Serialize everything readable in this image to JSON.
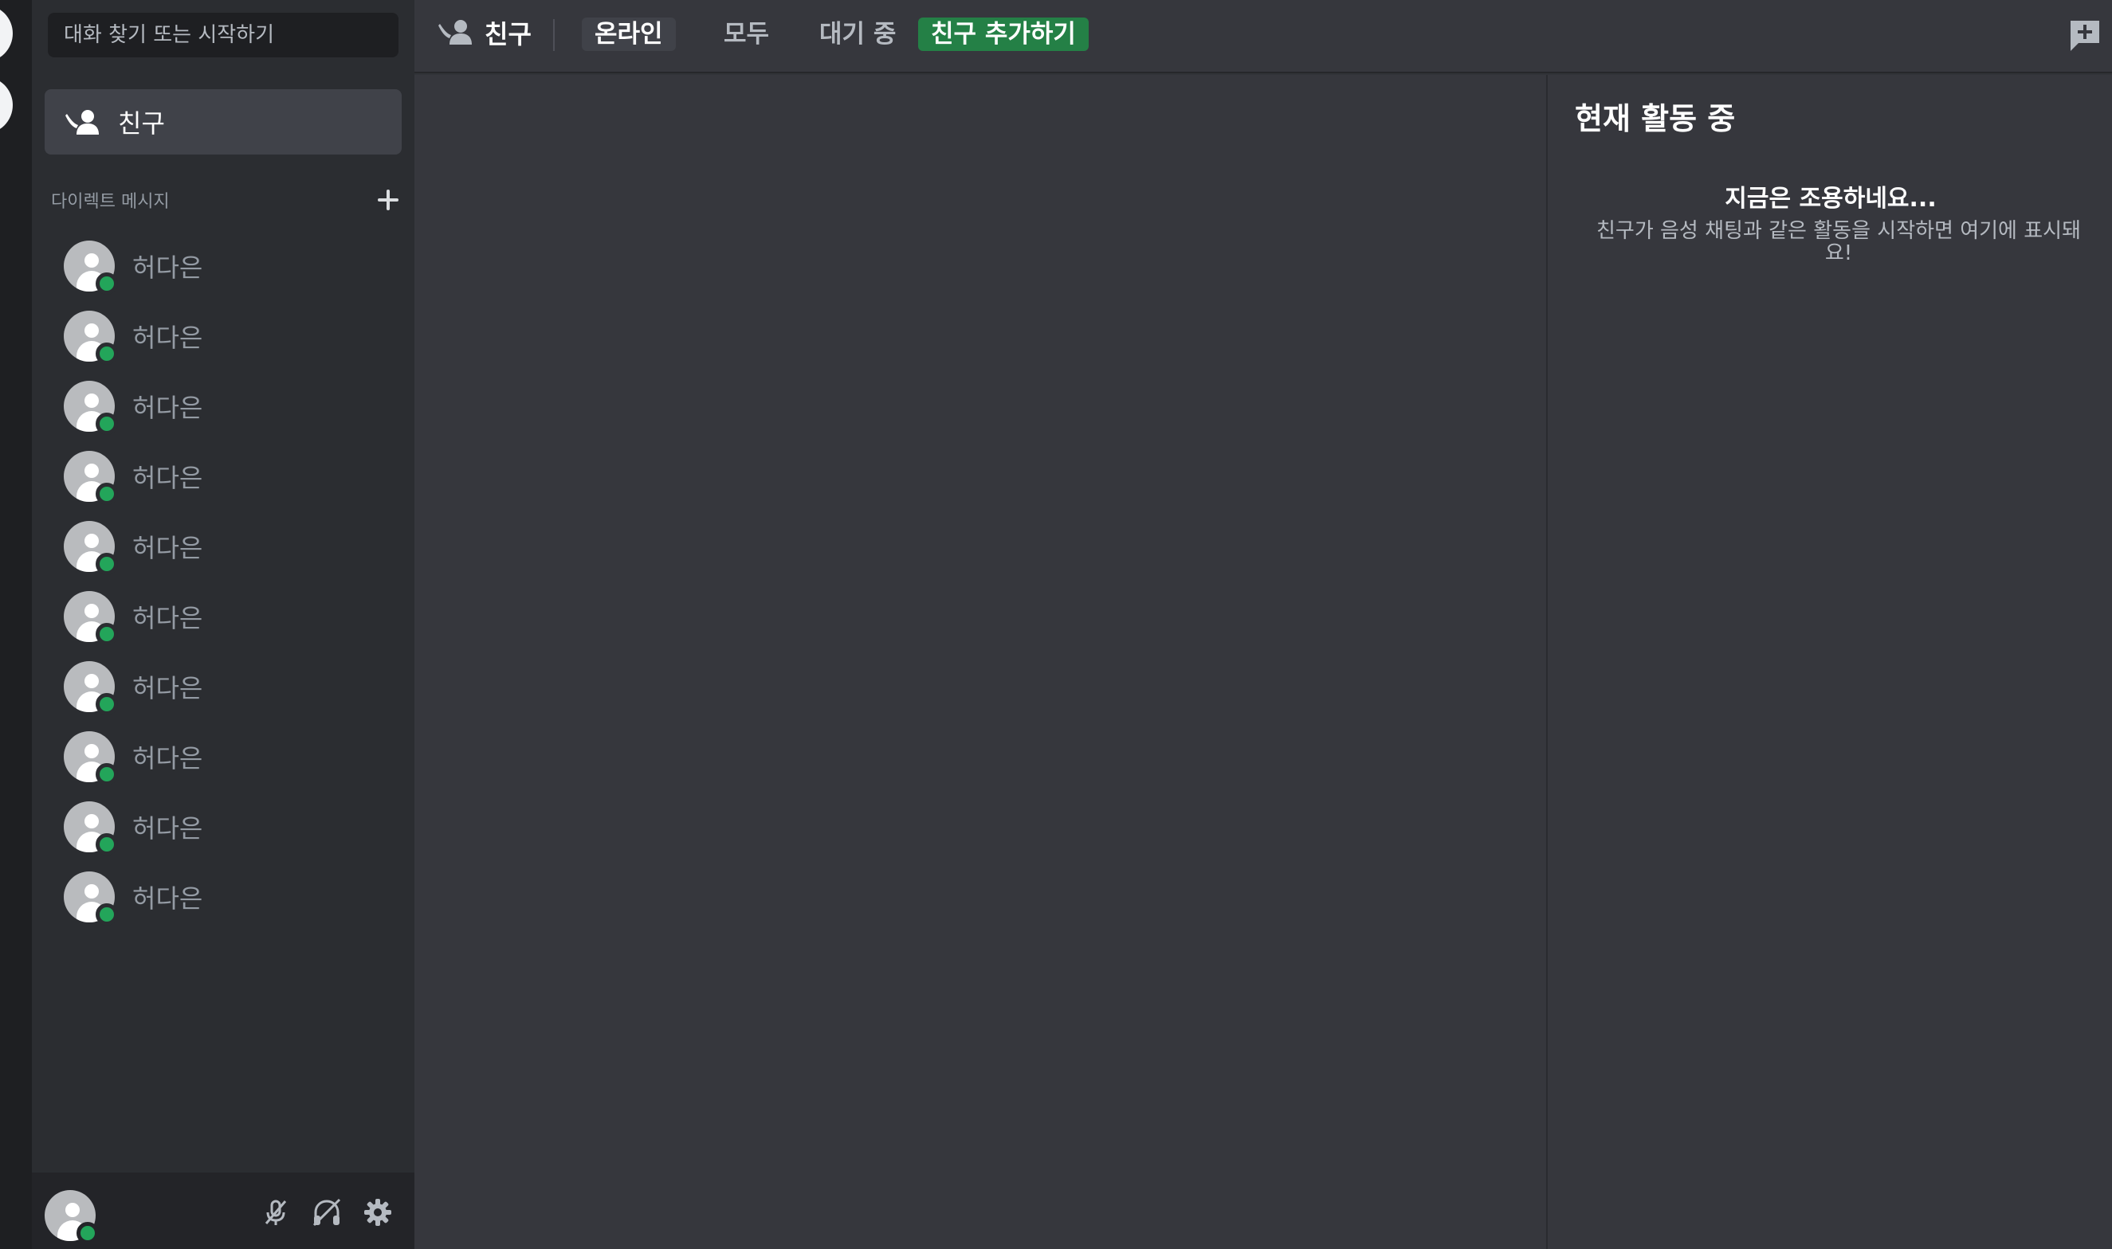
{
  "sidebar": {
    "search_placeholder": "대화 찾기 또는 시작하기",
    "friends_label": "친구",
    "dm_header": "다이렉트 메시지",
    "dms": [
      {
        "name": "허다은"
      },
      {
        "name": "허다은"
      },
      {
        "name": "허다은"
      },
      {
        "name": "허다은"
      },
      {
        "name": "허다은"
      },
      {
        "name": "허다은"
      },
      {
        "name": "허다은"
      },
      {
        "name": "허다은"
      },
      {
        "name": "허다은"
      },
      {
        "name": "허다은"
      }
    ]
  },
  "topbar": {
    "title": "친구",
    "tabs": [
      "온라인",
      "모두",
      "대기 중"
    ],
    "add_friend": "친구 추가하기"
  },
  "activity": {
    "title": "현재 활동 중",
    "empty_title": "지금은 조용하네요...",
    "empty_sub": "친구가 음성 채팅과 같은 활동을 시작하면 여기에 표시돼요!"
  },
  "colors": {
    "online": "#23a55a",
    "add_friend_button": "#248046"
  },
  "icons": {
    "friends": "waving-person-icon",
    "new_dm": "chat-plus-icon",
    "mute": "microphone-off-icon",
    "deafen": "headphones-off-icon",
    "settings": "gear-icon"
  }
}
